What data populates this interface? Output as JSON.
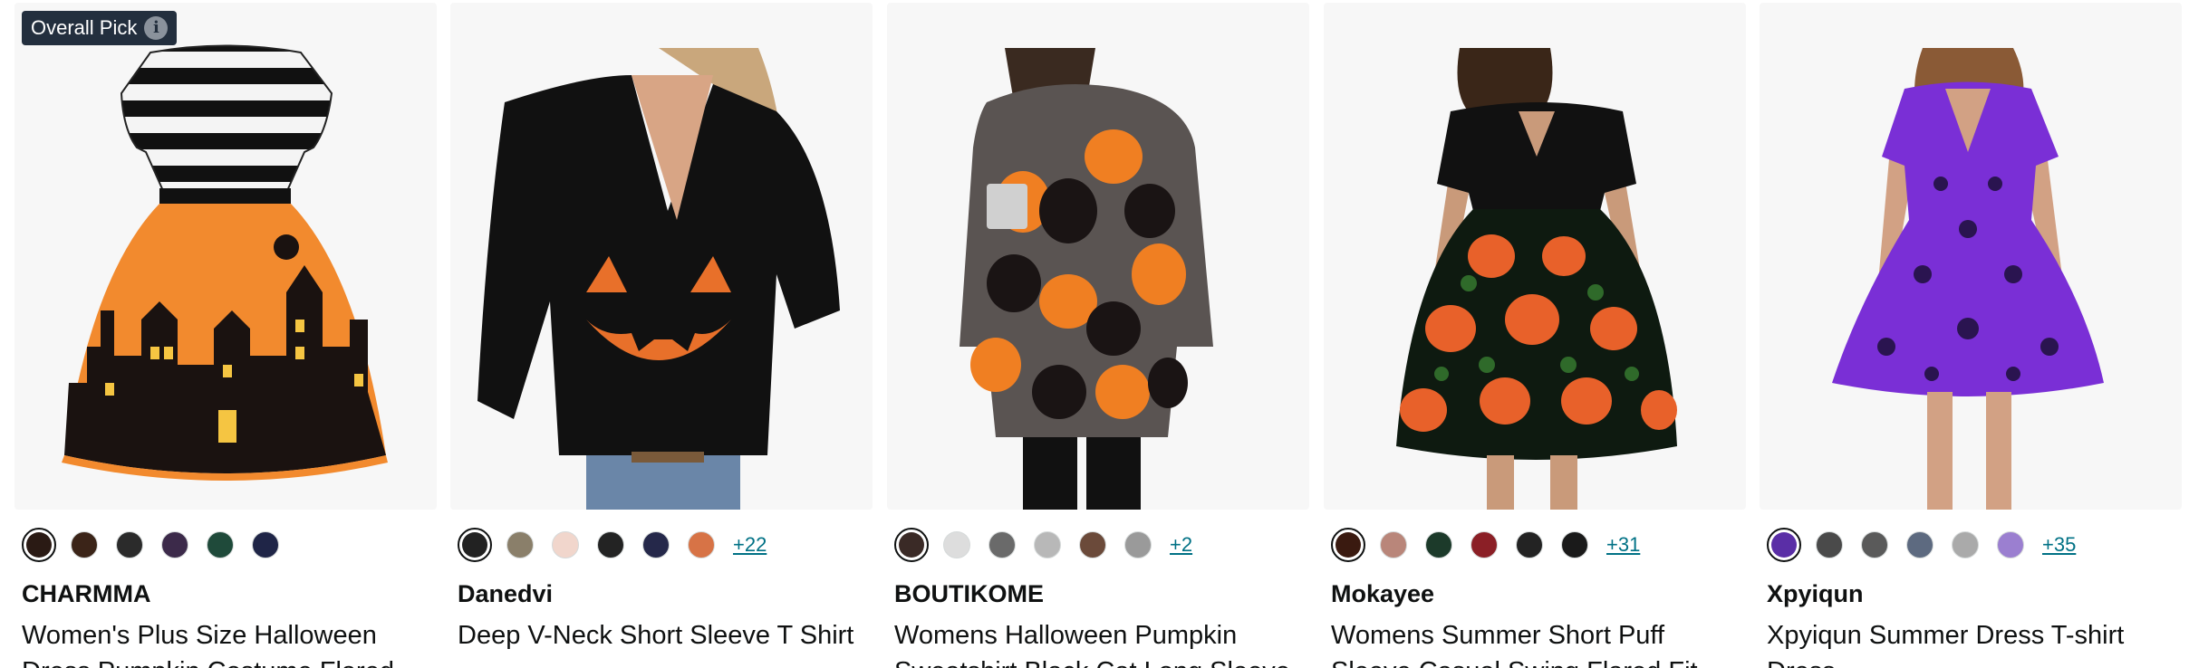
{
  "badge": {
    "label": "Overall Pick",
    "info_icon": "i"
  },
  "products": [
    {
      "brand": "CHARMMA",
      "title": "Women's Plus Size Halloween Dress Pumpkin Costume Flared",
      "swatches": [
        "#2a1a14",
        "#3b2418",
        "#2b2b2b",
        "#3c2a4a",
        "#1f4a3a",
        "#1f2547"
      ],
      "more": ""
    },
    {
      "brand": "Danedvi",
      "title": "Deep V-Neck Short Sleeve T Shirt",
      "swatches": [
        "#222222",
        "#8a7f6a",
        "#f1d6cc",
        "#232323",
        "#25284a",
        "#d77346"
      ],
      "more": "+22"
    },
    {
      "brand": "BOUTIKOME",
      "title": "Womens Halloween Pumpkin Sweatshirt Black Cat Long Sleeve",
      "swatches": [
        "#3a2a26",
        "#dddddd",
        "#6a6a6a",
        "#b8b8b8",
        "#6b4a3a",
        "#9a9a9a"
      ],
      "more": "+2"
    },
    {
      "brand": "Mokayee",
      "title": "Womens Summer Short Puff Sleeve Casual Swing Flared Fit",
      "swatches": [
        "#3a1a10",
        "#b9867a",
        "#1c3a2a",
        "#8b1f26",
        "#232323",
        "#1a1a1a"
      ],
      "more": "+31"
    },
    {
      "brand": "Xpyiqun",
      "title": "Xpyiqun Summer Dress T-shirt Dress",
      "swatches": [
        "#5a2ea6",
        "#4a4a4a",
        "#5a5a5a",
        "#5d6a80",
        "#aaaaaa",
        "#9b7fd0"
      ],
      "more": "+35"
    }
  ],
  "colors": {
    "brand_text": "#0f1111",
    "link": "#007185",
    "badge_bg": "#232f3e",
    "image_bg": "#f7f7f7"
  }
}
